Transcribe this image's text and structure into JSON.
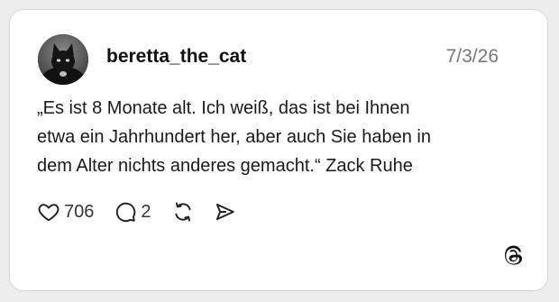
{
  "post": {
    "username": "beretta_the_cat",
    "date": "7/3/26",
    "text": "„Es ist 8 Monate alt. Ich weiß, das ist bei Ihnen\netwa ein Jahrhundert her, aber auch Sie haben in\ndem Alter nichts anderes gemacht.“ Zack Ruhe",
    "avatar_icon": "black-cat-avatar"
  },
  "actions": {
    "like_icon": "heart-icon",
    "like_count": "706",
    "reply_icon": "speech-bubble-icon",
    "reply_count": "2",
    "repost_icon": "repost-icon",
    "share_icon": "share-icon"
  },
  "brand": {
    "logo_icon": "threads-logo-icon"
  },
  "colors": {
    "background": "#ededed",
    "card": "#ffffff",
    "text": "#111111",
    "muted": "#777777"
  }
}
